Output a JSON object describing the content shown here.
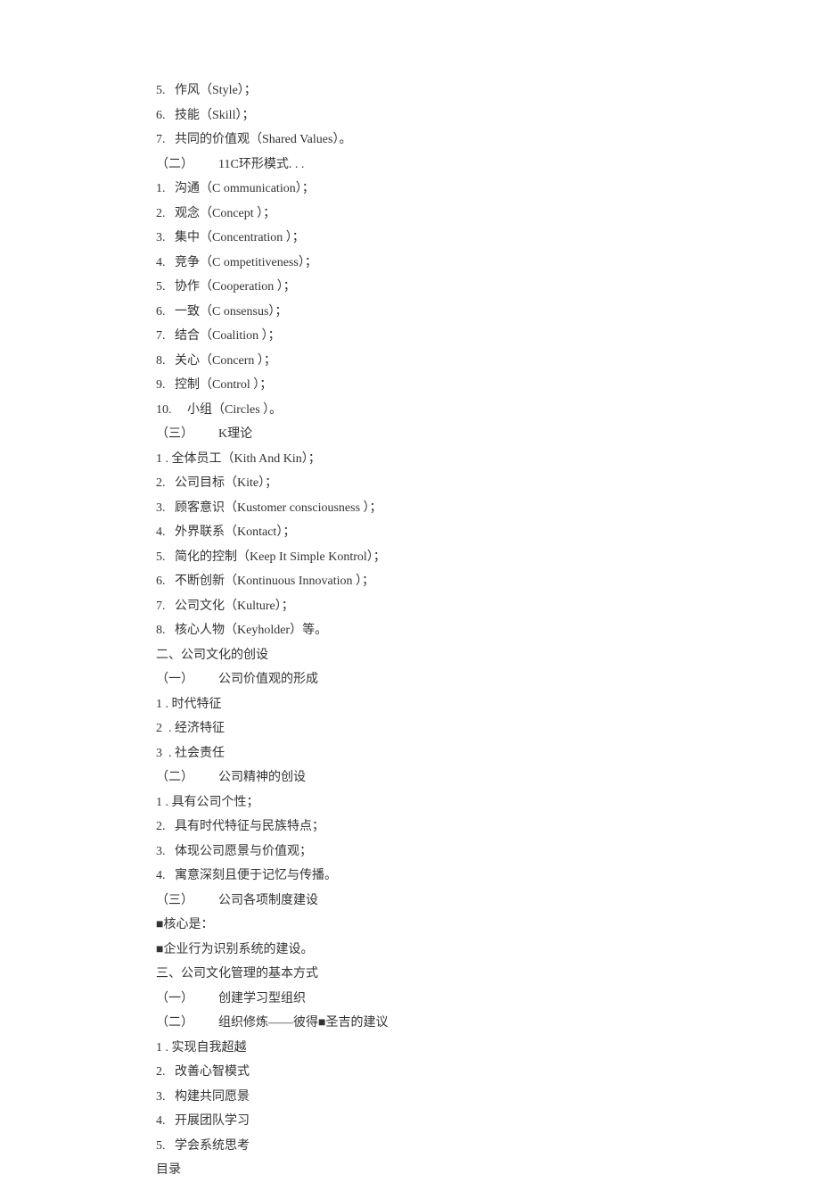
{
  "lines": [
    "5.   作风（Style）；",
    "6.   技能（Skill）；",
    "7.   共同的价值观（Shared Values）。",
    "（二）        11C环形模式. . .",
    "1.   沟通（C ommunication）；",
    "2.   观念（Concept ）；",
    "3.   集中（Concentration ）；",
    "4.   竞争（C ompetitiveness）；",
    "5.   协作（Cooperation ）；",
    "6.   一致（C onsensus）；",
    "7.   结合（Coalition ）；",
    "8.   关心（Concern ）；",
    "9.   控制（Control ）；",
    "10.     小组（Circles ）。",
    "（三）        K理论",
    "1 . 全体员工（Kith And Kin）；",
    "2.   公司目标（Kite）；",
    "3.   顾客意识（Kustomer consciousness ）；",
    "4.   外界联系（Kontact）；",
    "5.   简化的控制（Keep It Simple Kontrol）；",
    "6.   不断创新（Kontinuous Innovation ）；",
    "7.   公司文化（Kulture）；",
    "8.   核心人物（Keyholder）等。",
    "二、公司文化的创设",
    "（一）        公司价值观的形成",
    "1 . 时代特征",
    "2  . 经济特征",
    "3  . 社会责任",
    "（二）        公司精神的创设",
    "1 . 具有公司个性；",
    "2.   具有时代特征与民族特点；",
    "3.   体现公司愿景与价值观；",
    "4.   寓意深刻且便于记忆与传播。",
    "（三）        公司各项制度建设",
    "■核心是：",
    "■企业行为识别系统的建设。",
    "三、公司文化管理的基本方式",
    "（一）        创建学习型组织",
    "（二）        组织修炼——彼得■圣吉的建议",
    "1 . 实现自我超越",
    "2.   改善心智模式",
    "3.   构建共同愿景",
    "4.   开展团队学习",
    "5.   学会系统思考",
    "目录"
  ]
}
